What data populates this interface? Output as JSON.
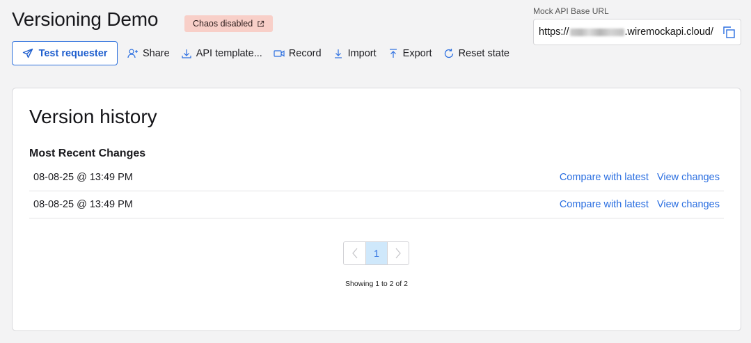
{
  "header": {
    "title": "Versioning Demo",
    "chaos_badge": "Chaos disabled"
  },
  "mock_api": {
    "label": "Mock API Base URL",
    "url_prefix": "https://",
    "url_suffix": ".wiremockapi.cloud/"
  },
  "toolbar": {
    "test_requester": "Test requester",
    "share": "Share",
    "api_template": "API template...",
    "record": "Record",
    "import": "Import",
    "export": "Export",
    "reset_state": "Reset state"
  },
  "version_history": {
    "title": "Version history",
    "section": "Most Recent Changes",
    "rows": [
      {
        "date": "08-08-25 @ 13:49 PM",
        "compare": "Compare with latest",
        "view": "View changes"
      },
      {
        "date": "08-08-25 @ 13:49 PM",
        "compare": "Compare with latest",
        "view": "View changes"
      }
    ]
  },
  "pagination": {
    "current_page": "1",
    "showing": "Showing 1 to 2 of 2"
  },
  "colors": {
    "accent": "#2a6ee0",
    "badge_bg": "#f8cfc8",
    "active_page_bg": "#cfe8fb"
  }
}
